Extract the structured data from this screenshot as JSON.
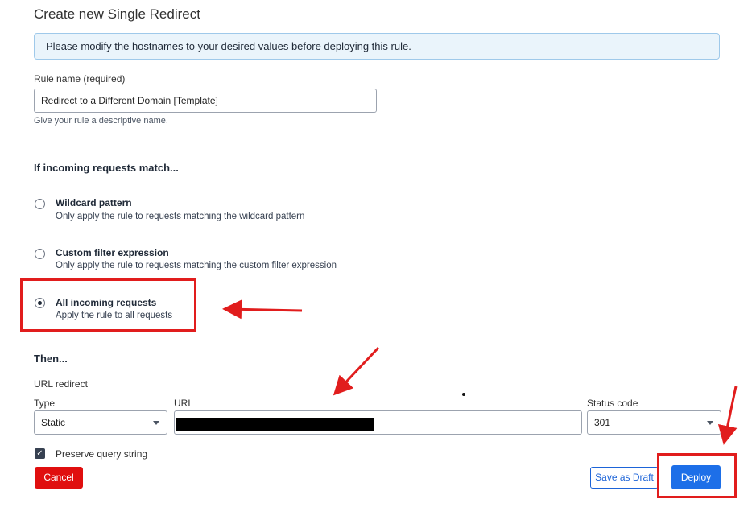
{
  "page": {
    "title": "Create new Single Redirect",
    "banner": "Please modify the hostnames to your desired values before deploying this rule."
  },
  "rule_name": {
    "label": "Rule name (required)",
    "value": "Redirect to a Different Domain [Template]",
    "help": "Give your rule a descriptive name."
  },
  "match": {
    "heading": "If incoming requests match...",
    "options": [
      {
        "title": "Wildcard pattern",
        "desc": "Only apply the rule to requests matching the wildcard pattern",
        "checked": false
      },
      {
        "title": "Custom filter expression",
        "desc": "Only apply the rule to requests matching the custom filter expression",
        "checked": false
      },
      {
        "title": "All incoming requests",
        "desc": "Apply the rule to all requests",
        "checked": true
      }
    ]
  },
  "then": {
    "heading": "Then...",
    "action_label": "URL redirect",
    "type_label": "Type",
    "type_value": "Static",
    "url_label": "URL",
    "status_label": "Status code",
    "status_value": "301",
    "preserve_label": "Preserve query string",
    "preserve_checked": true
  },
  "actions": {
    "cancel": "Cancel",
    "save_draft": "Save as Draft",
    "deploy": "Deploy"
  },
  "annotation_color": "#e11d1d"
}
